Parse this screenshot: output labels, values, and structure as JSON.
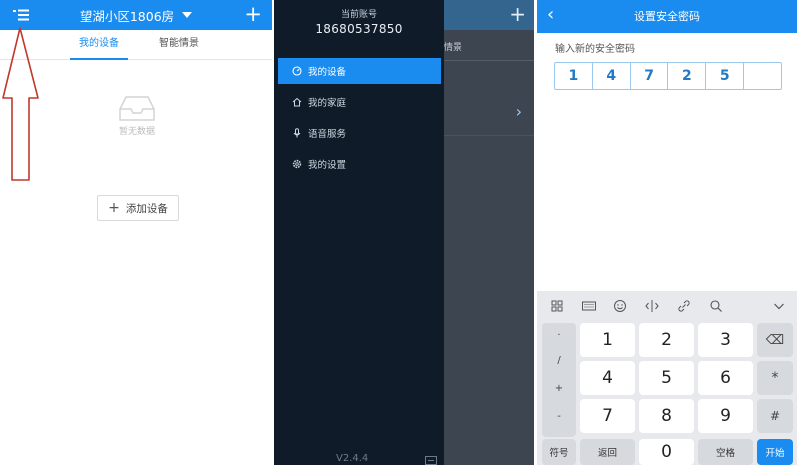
{
  "panel1": {
    "header": {
      "title": "望湖小区1806房",
      "plus": "+"
    },
    "tabs": [
      {
        "label": "我的设备"
      },
      {
        "label": "智能情景"
      }
    ],
    "empty_text": "暂无数据",
    "add_button": {
      "icon": "+",
      "label": "添加设备"
    },
    "colors": {
      "accent": "#1a8cf0",
      "annotation_arrow": "#c0392b"
    }
  },
  "panel2": {
    "account_label": "当前账号",
    "account_phone": "18680537850",
    "behind_tab_text": "情景",
    "behind_plus": "+",
    "behind_chevron": "›",
    "menu": [
      {
        "label": "我的设备",
        "icon": "dashboard-icon",
        "active": true
      },
      {
        "label": "我的家庭",
        "icon": "home-icon",
        "active": false
      },
      {
        "label": "语音服务",
        "icon": "microphone-icon",
        "active": false
      },
      {
        "label": "我的设置",
        "icon": "gear-icon",
        "active": false
      }
    ],
    "version": "V2.4.4",
    "colors": {
      "drawer_bg": "#0f1b29",
      "active": "#1a8cf0"
    }
  },
  "panel3": {
    "header": {
      "back": "‹",
      "title": "设置安全密码"
    },
    "prompt": "输入新的安全密码",
    "pin_digits": [
      "1",
      "4",
      "7",
      "2",
      "5",
      ""
    ],
    "keyboard": {
      "toolbar_icons": [
        "grid-icon",
        "keyboard-icon",
        "emoji-icon",
        "cursor-icon",
        "link-icon",
        "search-icon",
        "collapse-icon"
      ],
      "symbols": [
        ".",
        "/",
        "+",
        "-"
      ],
      "digits": [
        "1",
        "2",
        "3",
        "4",
        "5",
        "6",
        "7",
        "8",
        "9"
      ],
      "side_keys": [
        "⌫",
        "*",
        "#"
      ],
      "bottom": {
        "symbols": "符号",
        "back": "返回",
        "zero": "0",
        "space": "空格",
        "start": "开始"
      }
    }
  }
}
